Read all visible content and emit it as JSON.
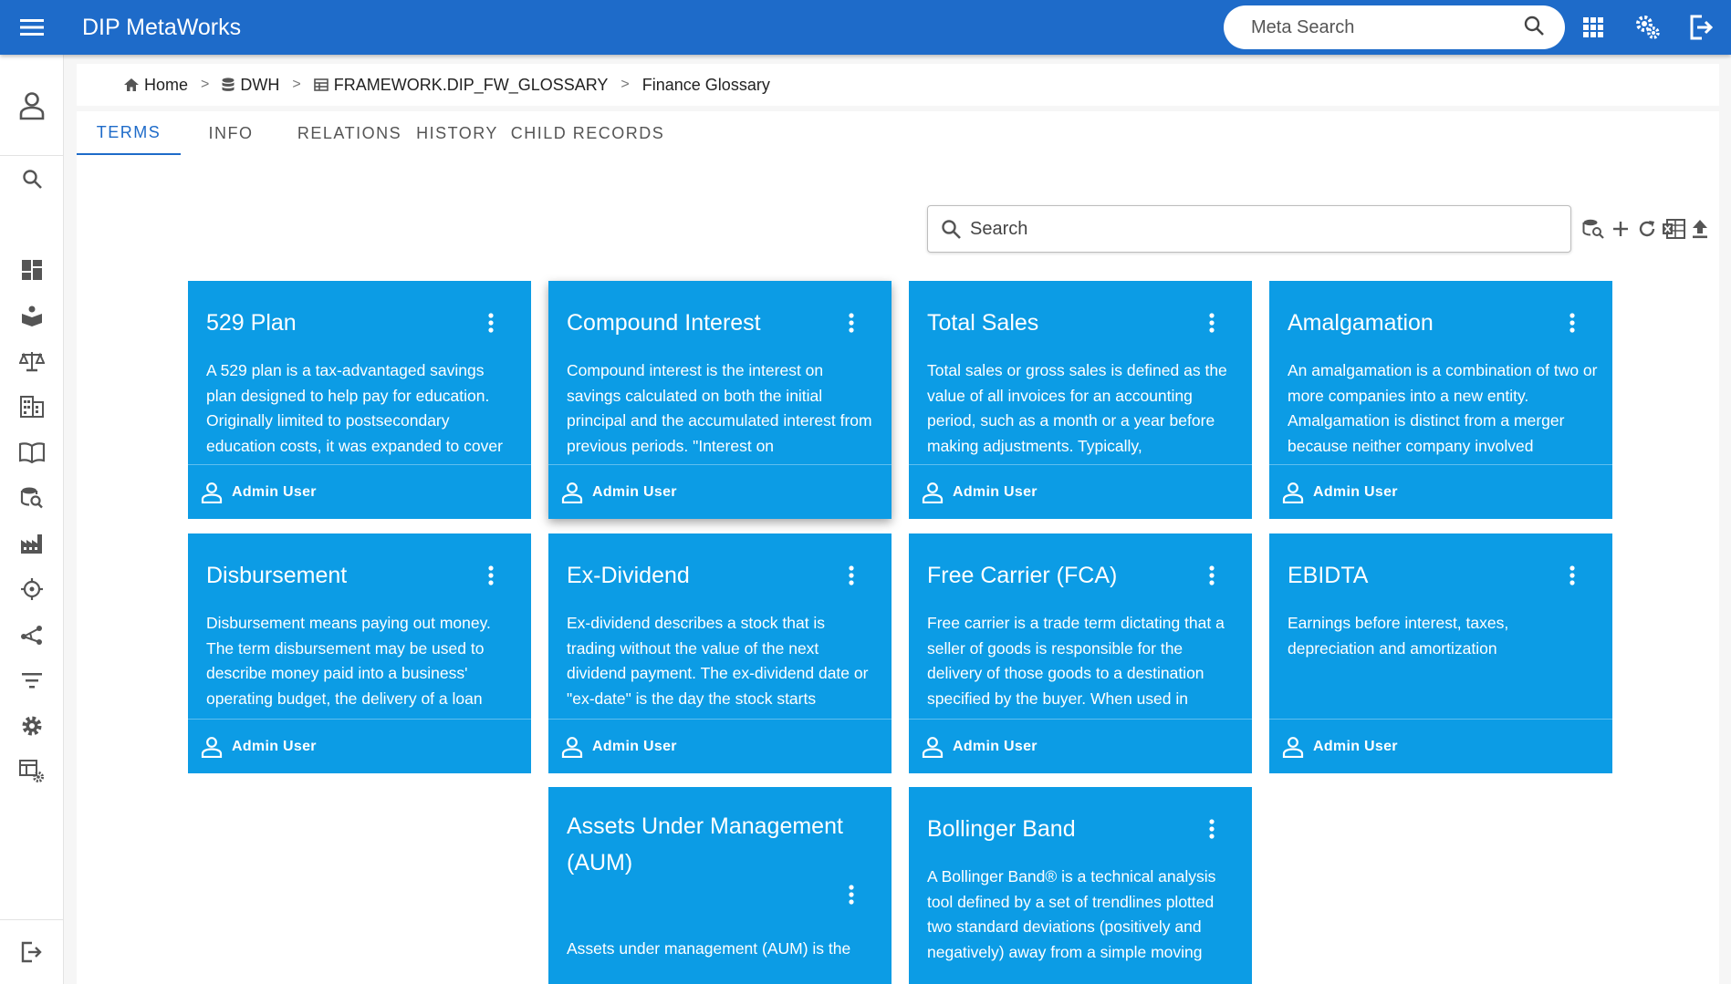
{
  "app": {
    "title": "DIP MetaWorks"
  },
  "topbar": {
    "search_placeholder": "Meta Search"
  },
  "breadcrumb": [
    {
      "label": "Home",
      "icon": "home-icon"
    },
    {
      "label": "DWH",
      "icon": "database-icon"
    },
    {
      "label": "FRAMEWORK.DIP_FW_GLOSSARY",
      "icon": "table-icon"
    },
    {
      "label": "Finance Glossary",
      "icon": ""
    }
  ],
  "breadcrumb_separator": ">",
  "tabs": [
    {
      "label": "TERMS",
      "active": true
    },
    {
      "label": "INFO",
      "active": false
    },
    {
      "label": "RELATIONS",
      "active": false
    },
    {
      "label": "HISTORY",
      "active": false
    },
    {
      "label": "CHILD RECORDS",
      "active": false
    }
  ],
  "terms_search": {
    "placeholder": "Search"
  },
  "cards": [
    {
      "title": "529 Plan",
      "description": "A 529 plan is a tax-advantaged savings plan designed to help pay for education. Originally limited to postsecondary education costs, it was expanded to cover",
      "user": "Admin User"
    },
    {
      "title": "Compound Interest",
      "description": "Compound interest is the interest on savings calculated on both the initial principal and the accumulated interest from previous periods. \"Interest on",
      "user": "Admin User"
    },
    {
      "title": "Total Sales",
      "description": "Total sales or gross sales is defined as the value of all invoices for an accounting period, such as a month or a year before making adjustments. Typically,",
      "user": "Admin User"
    },
    {
      "title": "Amalgamation",
      "description": "An amalgamation is a combination of two or more companies into a new entity. Amalgamation is distinct from a merger because neither company involved",
      "user": "Admin User"
    },
    {
      "title": "Disbursement",
      "description": "Disbursement means paying out money. The term disbursement may be used to describe money paid into a business' operating budget, the delivery of a loan",
      "user": "Admin User"
    },
    {
      "title": "Ex-Dividend",
      "description": "Ex-dividend describes a stock that is trading without the value of the next dividend payment. The ex-dividend date or \"ex-date\" is the day the stock starts",
      "user": "Admin User"
    },
    {
      "title": "Free Carrier (FCA)",
      "description": "Free carrier is a trade term dictating that a seller of goods is responsible for the delivery of those goods to a destination specified by the buyer. When used in",
      "user": "Admin User"
    },
    {
      "title": "EBIDTA",
      "description": "Earnings before interest, taxes, depreciation and amortization",
      "user": "Admin User"
    },
    {
      "title": "Assets Under Management (AUM)",
      "description": "Assets under management (AUM) is the",
      "user": ""
    },
    {
      "title": "Bollinger Band",
      "description": "A Bollinger Band® is a technical analysis tool defined by a set of trendlines plotted two standard deviations (positively and negatively) away from a simple moving",
      "user": ""
    }
  ],
  "colors": {
    "appbar": "#1e6bc9",
    "card": "#0c9ce5",
    "active_tab": "#1e6bc9"
  }
}
